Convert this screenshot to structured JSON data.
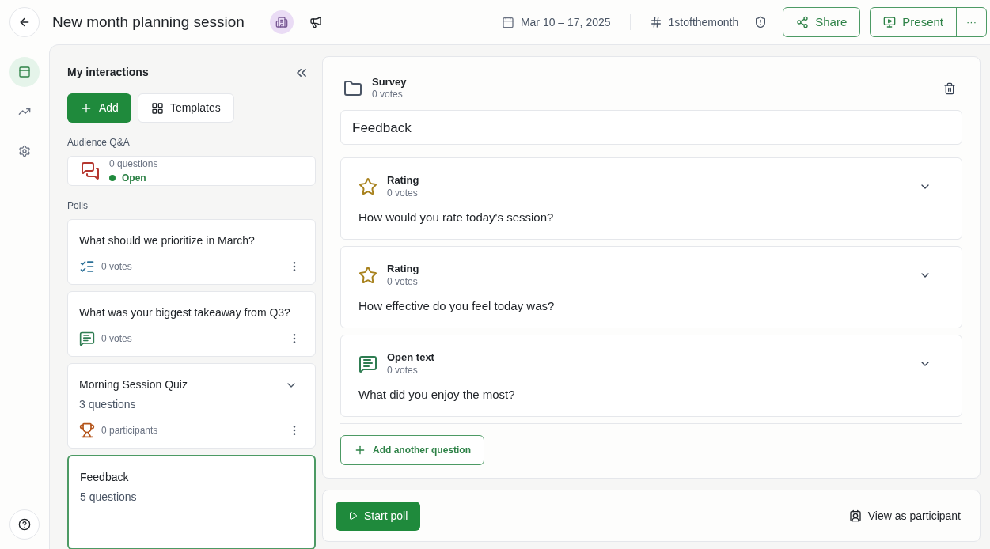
{
  "header": {
    "title": "New month planning session",
    "date": "Mar 10 – 17, 2025",
    "code": "1stofthemonth",
    "share": "Share",
    "present": "Present",
    "more": "···"
  },
  "rail": [
    {
      "kind": "interactions",
      "selected": true
    },
    {
      "kind": "analytics",
      "selected": false
    },
    {
      "kind": "settings",
      "selected": false
    }
  ],
  "sidebar": {
    "title": "My interactions",
    "add": "Add",
    "templates": "Templates",
    "qa_heading": "Audience Q&A",
    "qa": {
      "count": "0 questions",
      "status": "Open"
    },
    "polls_heading": "Polls",
    "polls": [
      {
        "kind": "choice",
        "title": "What should we prioritize in March?",
        "stat": "0 votes",
        "selected": false
      },
      {
        "kind": "open",
        "title": "What was your biggest takeaway from Q3?",
        "stat": "0 votes",
        "selected": false
      },
      {
        "kind": "quiz",
        "title": "Morning Session Quiz",
        "subtitle": "3 questions",
        "stat": "0 participants",
        "selected": false
      },
      {
        "kind": "survey",
        "title": "Feedback",
        "subtitle": "5 questions",
        "selected": true
      }
    ]
  },
  "editor": {
    "type": "Survey",
    "votes": "0 votes",
    "name": "Feedback",
    "questions": [
      {
        "kind": "rating",
        "type": "Rating",
        "votes": "0 votes",
        "text": "How would you rate today's session?"
      },
      {
        "kind": "rating",
        "type": "Rating",
        "votes": "0 votes",
        "text": "How effective do you feel today was?"
      },
      {
        "kind": "open",
        "type": "Open text",
        "votes": "0 votes",
        "text": "What did you enjoy the most?"
      }
    ],
    "add_question": "Add another question"
  },
  "footer": {
    "start": "Start poll",
    "view": "View as participant"
  }
}
